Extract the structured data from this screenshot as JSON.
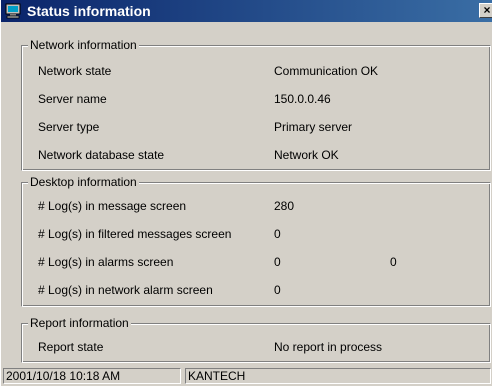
{
  "window": {
    "title": "Status information",
    "close_glyph": "×"
  },
  "network": {
    "legend": "Network information",
    "rows": [
      {
        "label": "Network state",
        "value": "Communication OK"
      },
      {
        "label": "Server name",
        "value": "150.0.0.46"
      },
      {
        "label": "Server type",
        "value": "Primary server"
      },
      {
        "label": "Network database state",
        "value": "Network OK"
      }
    ]
  },
  "desktop": {
    "legend": "Desktop information",
    "rows": [
      {
        "label": "# Log(s) in message screen",
        "value": "280"
      },
      {
        "label": "# Log(s) in filtered messages screen",
        "value": "0"
      },
      {
        "label": "# Log(s) in alarms screen",
        "value": "0",
        "extra": "0"
      },
      {
        "label": "# Log(s) in network alarm screen",
        "value": "0"
      }
    ]
  },
  "report": {
    "legend": "Report information",
    "rows": [
      {
        "label": "Report state",
        "value": "No report in process"
      }
    ]
  },
  "statusbar": {
    "datetime": "2001/10/18 10:18 AM",
    "company": "KANTECH"
  },
  "icons": {
    "title_icon": "computer-icon",
    "close_icon": "close-icon"
  }
}
